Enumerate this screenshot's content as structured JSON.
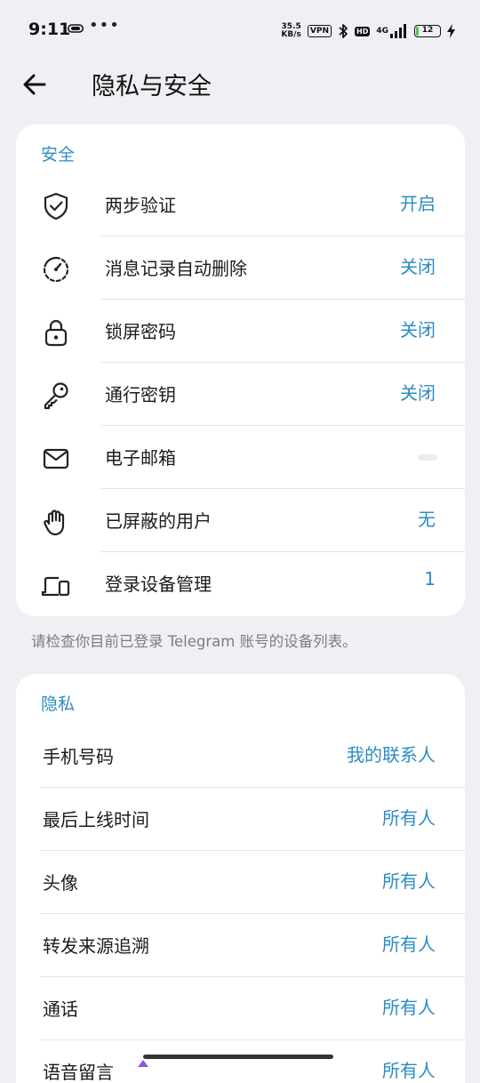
{
  "status_bar": {
    "time": "9:11",
    "more": "•••",
    "net_speed_value": "35.5",
    "net_speed_unit": "KB/s",
    "vpn": "VPN",
    "hd": "HD",
    "network": "4G",
    "battery": "12",
    "battery_level": 0.12,
    "battery_color": "#55c24c"
  },
  "header": {
    "title": "隐私与安全",
    "back_icon": "arrow-left-icon"
  },
  "security": {
    "title": "安全",
    "items": [
      {
        "label": "两步验证",
        "value": "开启",
        "icon": "shield-check-icon"
      },
      {
        "label": "消息记录自动删除",
        "value": "关闭",
        "icon": "timer-icon"
      },
      {
        "label": "锁屏密码",
        "value": "关闭",
        "icon": "lock-icon"
      },
      {
        "label": "通行密钥",
        "value": "关闭",
        "icon": "key-icon"
      },
      {
        "label": "电子邮箱",
        "value": "",
        "icon": "mail-icon"
      },
      {
        "label": "已屏蔽的用户",
        "value": "无",
        "icon": "hand-icon"
      },
      {
        "label": "登录设备管理",
        "value": "1",
        "icon": "devices-icon"
      }
    ],
    "footnote": "请检查你目前已登录 Telegram 账号的设备列表。"
  },
  "privacy": {
    "title": "隐私",
    "items": [
      {
        "label": "手机号码",
        "value": "我的联系人"
      },
      {
        "label": "最后上线时间",
        "value": "所有人"
      },
      {
        "label": "头像",
        "value": "所有人"
      },
      {
        "label": "转发来源追溯",
        "value": "所有人"
      },
      {
        "label": "通话",
        "value": "所有人"
      },
      {
        "label": "语音留言",
        "value": "所有人"
      }
    ]
  },
  "colors": {
    "accent": "#2c8cc3",
    "background": "#f0f0f4",
    "card": "#ffffff"
  }
}
